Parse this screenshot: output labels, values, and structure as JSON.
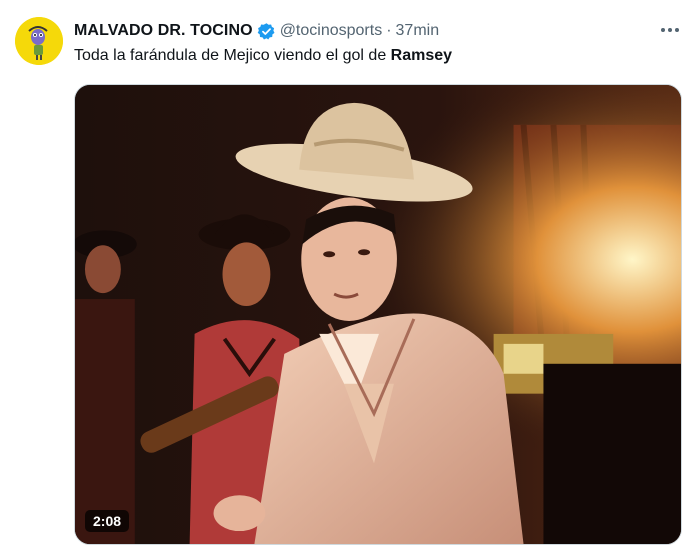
{
  "tweet": {
    "display_name": "MALVADO DR. TOCINO",
    "handle": "@tocinosports",
    "separator": "·",
    "time": "37min",
    "text_before": "Toda la farándula de Mejico viendo el gol de ",
    "text_bold": "Ramsey",
    "video_duration": "2:08"
  },
  "icons": {
    "verified": "verified-badge-icon",
    "more": "more-dots-icon",
    "avatar": "cartoon-character-avatar"
  },
  "colors": {
    "verified_blue": "#1d9bf0",
    "secondary_text": "#536471",
    "avatar_bg": "#f5d90a"
  }
}
